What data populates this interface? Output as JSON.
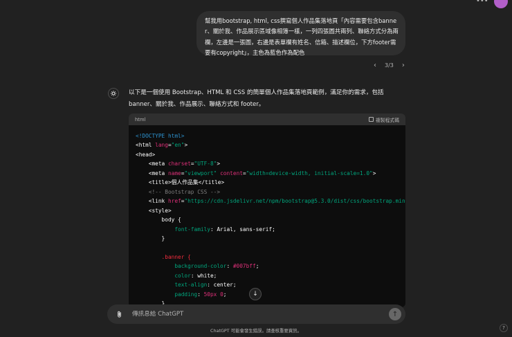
{
  "header": {
    "menu_icon": "more-icon"
  },
  "user_message": {
    "text": "幫我用bootstrap, html, css撰寫個人作品集落地頁「內容需要包含banner、關於我、作品展示區域像相簿一樣，一列四張圖共兩列、聯絡方式分為兩欄，左邊是一張圖，右邊是表單欄有姓名、信箱、描述欄位，下方footer需要有copyright」，主色為藍色作為配色"
  },
  "pager": {
    "prev": "‹",
    "label": "3/3",
    "next": "›"
  },
  "assistant": {
    "text": "以下是一個使用 Bootstrap、HTML 和 CSS 的簡單個人作品集落地頁範例，滿足你的需求，包括 banner、關於我、作品展示、聯絡方式和 footer。"
  },
  "code_block": {
    "language": "html",
    "copy_label": "複製程式碼",
    "lines": {
      "l1": "<!DOCTYPE html>",
      "l2_open": "<html ",
      "l2_attr": "lang",
      "l2_eq": "=",
      "l2_val": "\"en\"",
      "l2_close": ">",
      "l3": "<head>",
      "l4_open": "    <meta ",
      "l4_attr": "charset",
      "l4_eq": "=",
      "l4_val": "\"UTF-8\"",
      "l4_close": ">",
      "l5_open": "    <meta ",
      "l5_attr1": "name",
      "l5_eq1": "=",
      "l5_val1": "\"viewport\"",
      "l5_sp": " ",
      "l5_attr2": "content",
      "l5_eq2": "=",
      "l5_val2": "\"width=device-width, initial-scale=1.0\"",
      "l5_close": ">",
      "l6": "    <title>個人作品集</title>",
      "l7": "    <!-- Bootstrap CSS -->",
      "l8_open": "    <link ",
      "l8_attr": "href",
      "l8_eq": "=",
      "l8_val": "\"https://cdn.jsdelivr.net/npm/bootstrap@5.3.0/dist/css/bootstrap.min",
      "l9": "    <style>",
      "l10": "        body {",
      "l11_prop": "            font-family",
      "l11_rest": ": Arial, sans-serif;",
      "l12": "        }",
      "l13": "",
      "l14": "        .banner {",
      "l15_prop": "            background-color",
      "l15_colon": ": ",
      "l15_val": "#007bff",
      "l15_end": ";",
      "l16_prop": "            color",
      "l16_rest": ": white;",
      "l17_prop": "            text-align",
      "l17_rest": ": center;",
      "l18_prop": "            padding",
      "l18_colon": ": ",
      "l18_val": "50px 0",
      "l18_end": ";",
      "l19": "        }"
    }
  },
  "scroll_down": {
    "icon": "arrow-down-icon",
    "glyph": "↓"
  },
  "composer": {
    "placeholder": "傳訊息給 ChatGPT",
    "send_glyph": "↑"
  },
  "footer": {
    "disclaimer": "ChatGPT 可能會發生錯誤。請查核重要資訊。",
    "help": "?"
  }
}
